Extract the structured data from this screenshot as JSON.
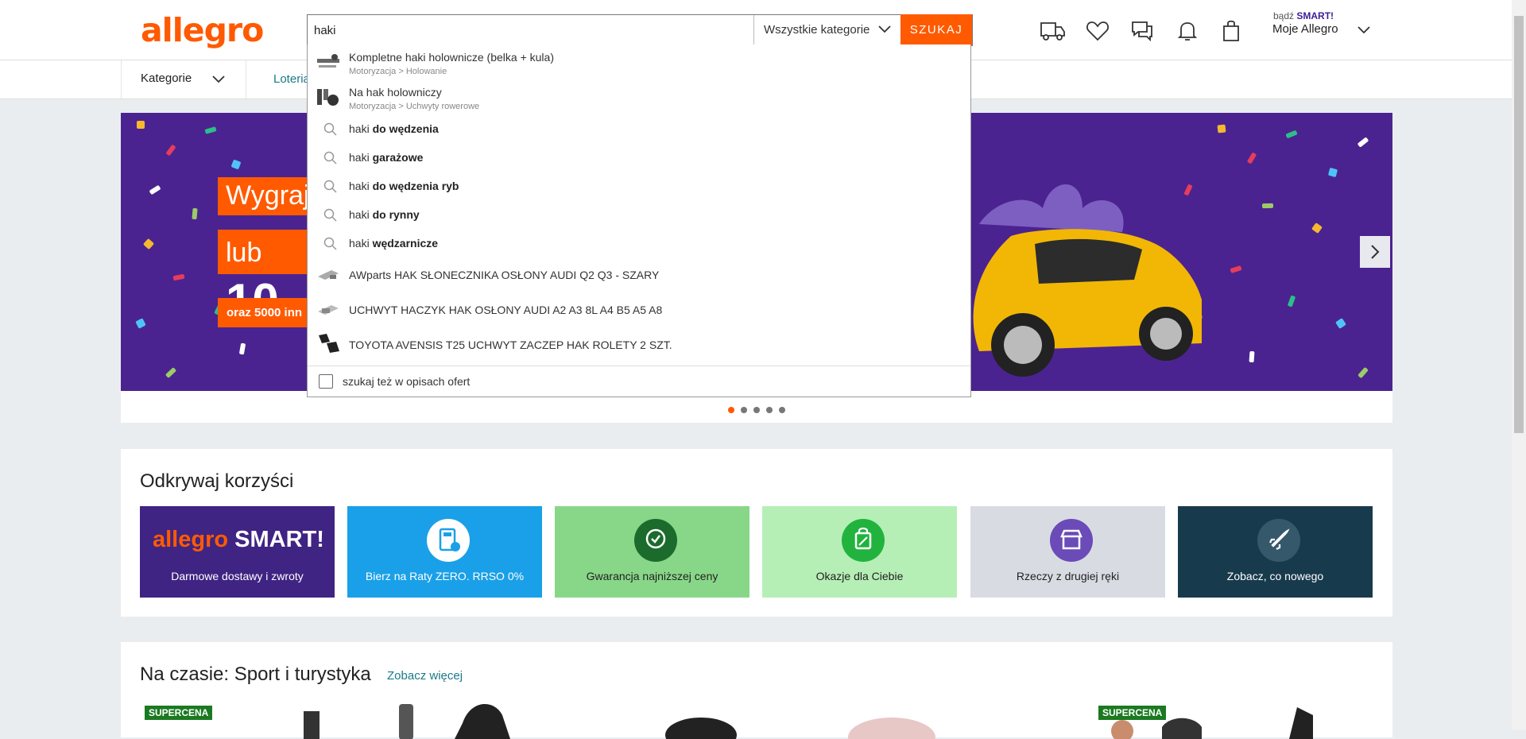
{
  "header": {
    "logo": "allegro",
    "search_value": "haki",
    "category": "Wszystkie kategorie",
    "search_button": "SZUKAJ",
    "smart_prefix": "bądź",
    "smart_brand": "SMART!",
    "account": "Moje Allegro"
  },
  "nav": {
    "kategorie": "Kategorie",
    "loteria": "Loteria"
  },
  "banner": {
    "promo_1": "Wygraj",
    "promo_2_prefix": "lub",
    "promo_2_big": "10",
    "promo_3": "oraz 5000 inn"
  },
  "suggestions": {
    "categories": [
      {
        "title": "Kompletne haki holownicze (belka + kula)",
        "path": "Motoryzacja > Holowanie"
      },
      {
        "title": "Na hak holowniczy",
        "path": "Motoryzacja > Uchwyty rowerowe"
      }
    ],
    "queries": [
      {
        "prefix": "haki",
        "bold": "do wędzenia"
      },
      {
        "prefix": "haki",
        "bold": "garażowe"
      },
      {
        "prefix": "haki",
        "bold": "do wędzenia ryb"
      },
      {
        "prefix": "haki",
        "bold": "do rynny"
      },
      {
        "prefix": "haki",
        "bold": "wędzarnicze"
      }
    ],
    "products": [
      "AWparts HAK SŁONECZNIKA OSŁONY AUDI Q2 Q3 - SZARY",
      "UCHWYT HACZYK HAK OSŁONY AUDI A2 A3 8L A4 B5 A5 A8",
      "TOYOTA AVENSIS T25 UCHWYT ZACZEP HAK ROLETY 2 SZT."
    ],
    "desc_checkbox": "szukaj też w opisach ofert"
  },
  "benefits": {
    "title": "Odkrywaj korzyści",
    "smart_logo_1": "allegro",
    "smart_logo_2": "SMART!",
    "tiles": [
      "Darmowe dostawy i zwroty",
      "Bierz na Raty ZERO. RRSO 0%",
      "Gwarancja najniższej ceny",
      "Okazje dla Ciebie",
      "Rzeczy z drugiej ręki",
      "Zobacz, co nowego"
    ]
  },
  "trending": {
    "title": "Na czasie: Sport i turystyka",
    "more": "Zobacz więcej",
    "badge": "SUPERCENA"
  },
  "colors": {
    "brand": "#ff5a00",
    "banner_bg": "#4b2390",
    "link": "#1a7a89"
  }
}
